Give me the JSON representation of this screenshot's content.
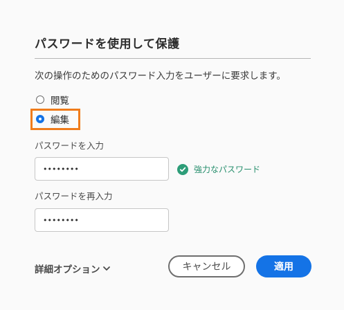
{
  "dialog": {
    "title": "パスワードを使用して保護",
    "description": "次の操作のためのパスワード入力をユーザーに要求します。",
    "radios": [
      {
        "label": "閲覧",
        "checked": false
      },
      {
        "label": "編集",
        "checked": true
      }
    ],
    "password": {
      "label": "パスワードを入力",
      "value": "••••••••"
    },
    "confirm": {
      "label": "パスワードを再入力",
      "value": "••••••••"
    },
    "strength": {
      "text": "強力なパスワード",
      "icon": "check-circle-icon",
      "color": "#2d9d78"
    },
    "advanced_label": "詳細オプション",
    "cancel_label": "キャンセル",
    "apply_label": "適用"
  },
  "colors": {
    "accent": "#1473e6",
    "focus": "#f07c1b",
    "success": "#2d9d78"
  }
}
